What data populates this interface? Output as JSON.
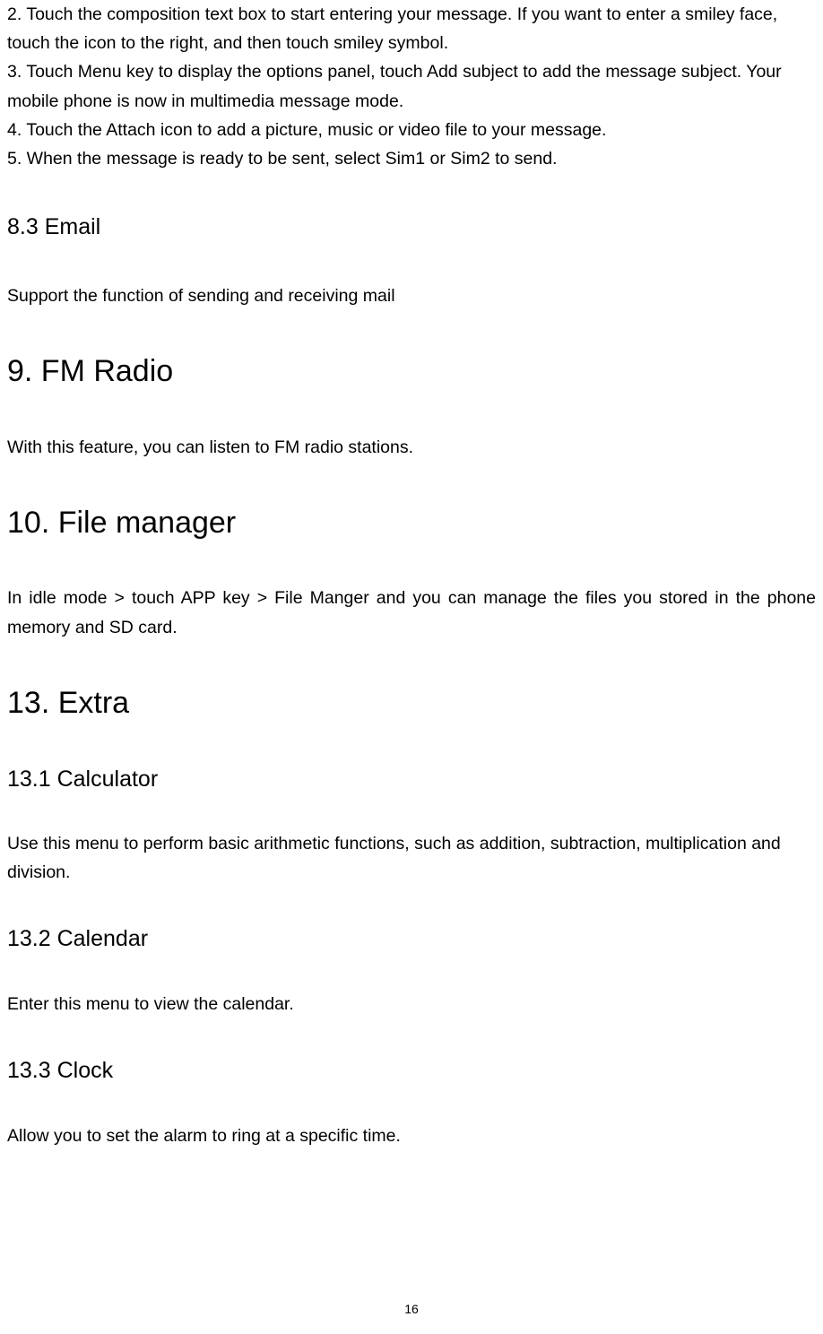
{
  "intro": {
    "step2": "2. Touch the composition text box to start entering your message. If you want to enter a smiley face, touch the icon to the right, and then touch smiley symbol.",
    "step3": "3. Touch Menu key to display the options panel, touch Add subject to add the message subject. Your mobile phone is now in multimedia message mode.",
    "step4": "4. Touch the Attach icon to add a picture, music or video file to your message.",
    "step5": "5. When the message is ready to be sent, select Sim1 or Sim2    to send."
  },
  "sections": {
    "email": {
      "title": "8.3 Email",
      "body": "Support the function of sending and receiving mail"
    },
    "fm": {
      "title": "9. FM Radio",
      "body": "With this feature, you can listen to FM radio stations."
    },
    "file": {
      "title": "10. File manager",
      "body": "In idle mode > touch APP key > File Manger and you can manage the files you stored in the phone memory and SD card."
    },
    "extra": {
      "title": "13. Extra"
    },
    "calc": {
      "title": "13.1 Calculator",
      "body": "Use this menu to perform basic arithmetic functions, such as addition, subtraction, multiplication and division."
    },
    "cal": {
      "title": "13.2 Calendar",
      "body": "Enter this menu to view the calendar."
    },
    "clock": {
      "title": "13.3 Clock",
      "body": "Allow you to set the alarm to ring at a specific time."
    }
  },
  "page_number": "16"
}
